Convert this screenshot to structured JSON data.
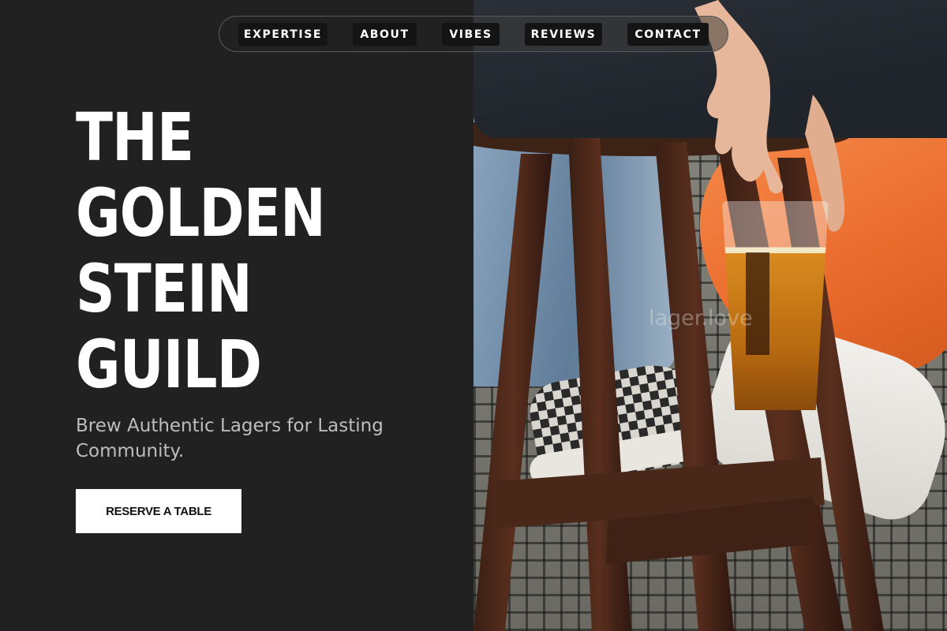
{
  "nav": {
    "items": [
      {
        "label": "EXPERTISE"
      },
      {
        "label": "ABOUT"
      },
      {
        "label": "VIBES"
      },
      {
        "label": "REVIEWS"
      },
      {
        "label": "CONTACT"
      }
    ]
  },
  "hero": {
    "title_lines": [
      "THE",
      "GOLDEN",
      "STEIN",
      "GUILD"
    ],
    "tagline": "Brew Authentic Lagers for Lasting Community.",
    "cta_label": "RESERVE A TABLE"
  },
  "photo": {
    "watermark": "lager.love"
  }
}
